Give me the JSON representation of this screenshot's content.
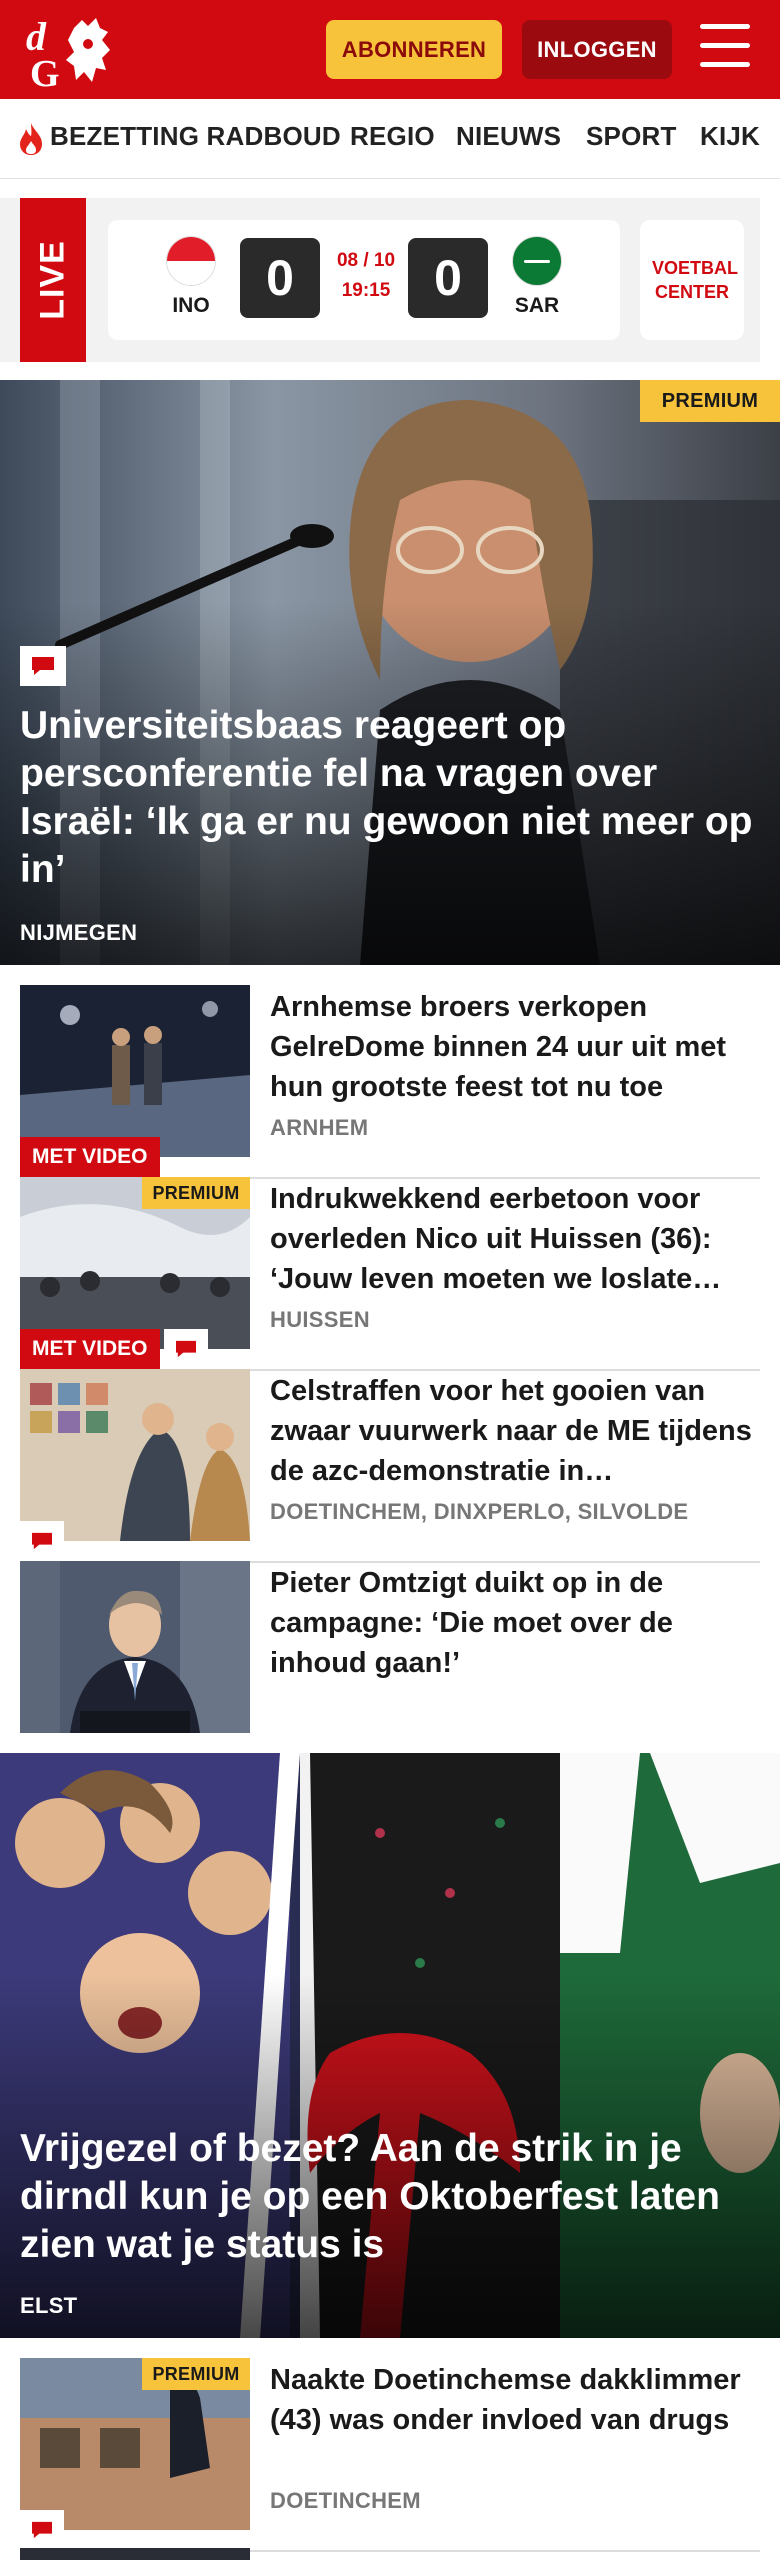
{
  "header": {
    "logo_text": "dG",
    "subscribe_label": "ABONNEREN",
    "login_label": "INLOGGEN"
  },
  "nav": {
    "items": [
      "BEZETTING RADBOUD",
      "REGIO",
      "NIEUWS",
      "SPORT",
      "KIJK"
    ]
  },
  "live": {
    "label": "LIVE",
    "home_team": "INO",
    "away_team": "SAR",
    "home_score": "0",
    "away_score": "0",
    "date": "08 / 10",
    "time": "19:15",
    "center_label": "VOETBAL CENTER"
  },
  "hero": {
    "premium_label": "PREMIUM",
    "title": "Universiteitsbaas reageert op persconferentie fel na vragen over Israël: ‘Ik ga er nu gewoon niet meer op in’",
    "location": "NIJMEGEN"
  },
  "articles": [
    {
      "title": "Arnhemse broers verkopen GelreDome binnen 24 uur uit met hun grootste feest tot nu toe",
      "location": "ARNHEM",
      "video_label": "MET VIDEO"
    },
    {
      "premium_label": "PREMIUM",
      "title": "Indrukwekkend eerbetoon voor overleden Nico uit Huissen (36): ‘Jouw leven moeten we loslate…",
      "location": "HUISSEN",
      "video_label": "MET VIDEO"
    },
    {
      "title": "Celstraffen voor het gooien van zwaar vuurwerk naar de ME tijdens de azc-demonstratie in…",
      "location": "DOETINCHEM, DINXPERLO, SILVOLDE"
    },
    {
      "title": "Pieter Omtzigt duikt op in de campagne: ‘Die moet over de inhoud gaan!’",
      "location": ""
    }
  ],
  "hero2": {
    "title": "Vrijgezel of bezet? Aan de strik in je dirndl kun je op een Oktoberfest laten zien wat je status is",
    "location": "ELST"
  },
  "articles2": [
    {
      "premium_label": "PREMIUM",
      "title": "Naakte Doetinchemse dakklimmer (43) was onder invloed van drugs",
      "location": "DOETINCHEM"
    }
  ],
  "colors": {
    "brand_red": "#d10a11",
    "premium_yellow": "#f6c33b",
    "dark_red": "#9b0a0f"
  }
}
